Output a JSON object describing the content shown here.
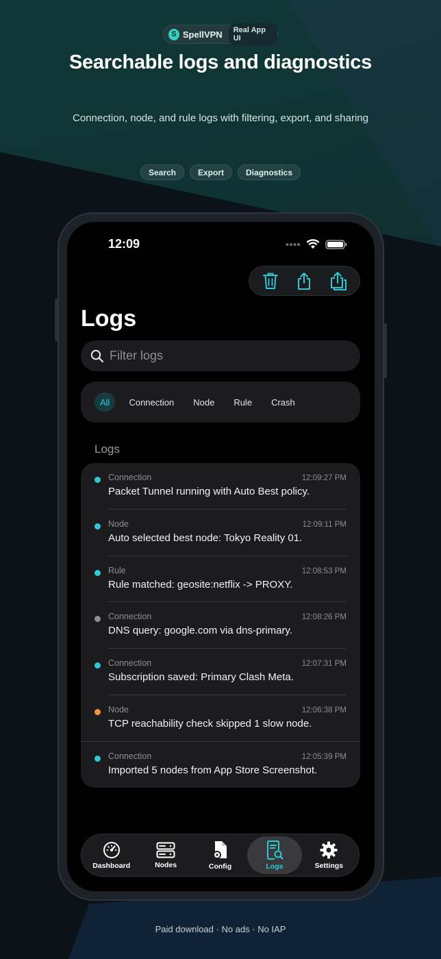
{
  "brand": {
    "logo_letter": "S",
    "name": "SpellVPN",
    "tag": "Real App UI"
  },
  "headline": "Searchable logs and diagnostics",
  "subline": "Connection, node, and rule logs with filtering, export, and sharing",
  "features": [
    "Search",
    "Export",
    "Diagnostics"
  ],
  "status_bar": {
    "time": "12:09"
  },
  "toolbar": {
    "icons": [
      "trash-icon",
      "share-icon",
      "export-icon"
    ]
  },
  "page_title": "Logs",
  "search": {
    "placeholder": "Filter logs",
    "value": ""
  },
  "filters": {
    "selected": "All",
    "items": [
      "All",
      "Connection",
      "Node",
      "Rule",
      "Crash"
    ]
  },
  "section_label": "Logs",
  "logs": [
    {
      "category": "Connection",
      "time": "12:09:27 PM",
      "message": "Packet Tunnel running with Auto Best policy.",
      "dot_color": "#2ec9d6"
    },
    {
      "category": "Node",
      "time": "12:09:11 PM",
      "message": "Auto selected best node: Tokyo Reality 01.",
      "dot_color": "#2ec9d6"
    },
    {
      "category": "Rule",
      "time": "12:08:53 PM",
      "message": "Rule matched: geosite:netflix -> PROXY.",
      "dot_color": "#2ec9d6"
    },
    {
      "category": "Connection",
      "time": "12:08:26 PM",
      "message": "DNS query: google.com via dns-primary.",
      "dot_color": "#8e8e93"
    },
    {
      "category": "Connection",
      "time": "12:07:31 PM",
      "message": "Subscription saved: Primary Clash Meta.",
      "dot_color": "#2ec9d6"
    },
    {
      "category": "Node",
      "time": "12:06:38 PM",
      "message": "TCP reachability check skipped 1 slow node.",
      "dot_color": "#f0963a"
    },
    {
      "category": "Connection",
      "time": "12:05:39 PM",
      "message": "Imported 5 nodes from App Store Screenshot.",
      "dot_color": "#2ec9d6"
    }
  ],
  "tabbar": {
    "selected": "Logs",
    "tabs": [
      {
        "label": "Dashboard",
        "icon": "gauge-icon"
      },
      {
        "label": "Nodes",
        "icon": "server-icon"
      },
      {
        "label": "Config",
        "icon": "config-file-icon"
      },
      {
        "label": "Logs",
        "icon": "log-search-icon"
      },
      {
        "label": "Settings",
        "icon": "gear-icon"
      }
    ]
  },
  "footer": "Paid download · No ads · No IAP",
  "colors": {
    "accent": "#2ec9d6",
    "brand": "#2fd1bf",
    "warning": "#f0963a"
  }
}
